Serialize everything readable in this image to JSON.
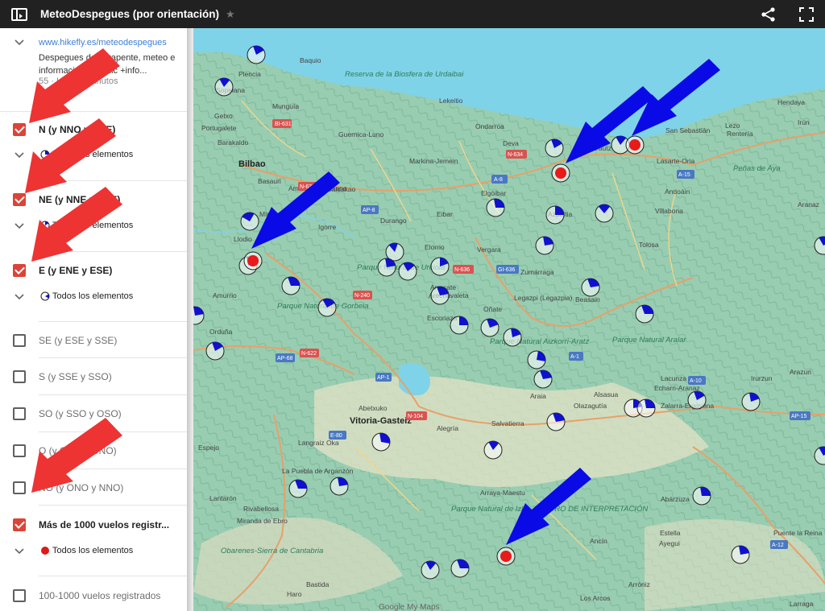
{
  "app": {
    "title": "MeteoDespegues (por orientación)",
    "star_icon": "star-icon",
    "share_icon": "share-icon",
    "fullscreen_icon": "fullscreen-icon",
    "sidebar_toggle_icon": "sidebar-toggle-icon"
  },
  "description": {
    "link": "www.hikefly.es/meteodespegues",
    "text": "Despegues de parapente, meteo e información. 👆 Clic +info...",
    "views": "55",
    "updated": "Hace 5 minutos"
  },
  "layers": [
    {
      "label": "N (y NNO y NNE)",
      "checked": true,
      "sublabel": "Todos los elementos",
      "symbol": "pie"
    },
    {
      "label": "NE (y NNE y ENE)",
      "checked": true,
      "sublabel": "Todos los elementos",
      "symbol": "pie"
    },
    {
      "label": "E (y ENE y ESE)",
      "checked": true,
      "sublabel": "Todos los elementos",
      "symbol": "pie"
    },
    {
      "label": "SE (y ESE y SSE)",
      "checked": false
    },
    {
      "label": "S (y SSE y SSO)",
      "checked": false
    },
    {
      "label": "SO (y SSO y OSO)",
      "checked": false
    },
    {
      "label": "O (y OSO y ONO)",
      "checked": false
    },
    {
      "label": "NO (y ONO y NNO)",
      "checked": false
    },
    {
      "label": "Más de 1000 vuelos registr...",
      "checked": true,
      "sublabel": "Todos los elementos",
      "symbol": "red-dot"
    },
    {
      "label": "100-1000 vuelos registrados",
      "checked": false
    }
  ],
  "map": {
    "attribution": "Google My Maps",
    "places": [
      "Baquio",
      "Plencia",
      "Sopelana",
      "Getxo",
      "Munguía",
      "Portugalete",
      "Barakaldo",
      "Bilbao",
      "Basauri",
      "Guernica-Luno",
      "Lekeitio",
      "Ondarroa",
      "Markina-Jemein",
      "Deva",
      "Zarautz",
      "San Sebastián",
      "Lasarte-Oria",
      "Hendaya",
      "Irún",
      "Rentería",
      "Lezo",
      "Andoáin",
      "Villabona",
      "Tolosa",
      "Azpeitia",
      "Elgóibar",
      "Eibar",
      "Durango",
      "Elorrio",
      "Vergara",
      "Zumárraga",
      "Legazpi (Legazpia)",
      "Beasain",
      "Galdakao",
      "Amorebieta-Etxano",
      "Igorre",
      "Miravalles",
      "Llodio",
      "Amurrio",
      "Orduña",
      "Arrasate",
      "Arechavaleta",
      "Escoriaza",
      "Oñate",
      "Abetxuko",
      "Vitoria-Gasteiz",
      "Alegría",
      "Salvatierra",
      "Langraiz Oka",
      "Espejo",
      "La Puebla de Arganzón",
      "Lantarón",
      "Rivabellosa",
      "Miranda de Ebro",
      "Arraya-Maestu",
      "Alsasua",
      "Olazagutía",
      "Zalarra-Ergoyena",
      "Lacunza",
      "Echarri-Aranaz",
      "Irurzun",
      "Abárzuza",
      "Estella",
      "Ayegui",
      "Ancín",
      "Puente la Reina",
      "Larraga",
      "Arróniz",
      "Los Arcos",
      "Bastida",
      "Haro",
      "Arazuri",
      "Aranaz",
      "Araia"
    ],
    "parks": [
      "Reserva de la Biosfera de Urdaibai",
      "Parque Natural de Urkiola",
      "Parque Natural de Gorbeia",
      "Parque Natural Aizkorri-Aratz",
      "Parque Natural Aralar",
      "Peñas de Aya",
      "Parque Natural de Izki · CENTRO DE INTERPRETACIÓN",
      "Obarenes-Sierra de Cantabria"
    ],
    "roads": [
      "BI-631",
      "N-637",
      "N-634",
      "A-8",
      "AP-8",
      "AP-1",
      "A-1",
      "N-636",
      "N-240",
      "N-622",
      "AP-68",
      "N-104",
      "E-80",
      "A-10",
      "A-15",
      "A-12",
      "AP-15",
      "GI-636"
    ]
  },
  "colors": {
    "accent_red": "#db4437",
    "topbar": "#212121",
    "pie_blue": "#1010d0",
    "dot_red": "#e81a1a",
    "arrow_red": "#ee3333",
    "arrow_blue": "#0a0ae6",
    "sea": "#7fd3e8"
  }
}
